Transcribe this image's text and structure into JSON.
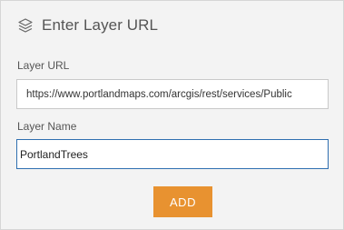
{
  "header": {
    "icon": "layers-icon",
    "title": "Enter Layer URL"
  },
  "form": {
    "url_label": "Layer URL",
    "url_value": "https://www.portlandmaps.com/arcgis/rest/services/Public",
    "name_label": "Layer Name",
    "name_value": "PortlandTrees"
  },
  "actions": {
    "add_label": "ADD"
  },
  "colors": {
    "accent": "#e89230",
    "focus_border": "#2f6fb0",
    "panel_bg": "#f3f3f3"
  }
}
